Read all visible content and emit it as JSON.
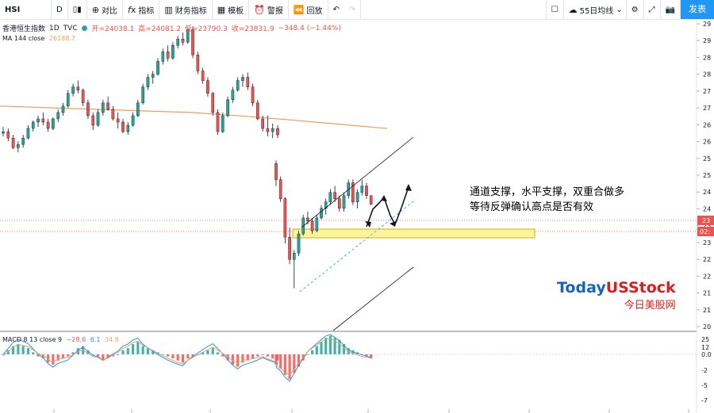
{
  "toolbar": {
    "symbol": "HSI",
    "interval": "D",
    "compare": "对比",
    "indicators": "指标",
    "financials": "财务指标",
    "templates": "模板",
    "alert": "警报",
    "replay": "回放",
    "ma_setting": "55日均线",
    "publish": "发表"
  },
  "legend": {
    "name": "香港恒生指数",
    "interval": "1D",
    "source": "TVC",
    "open": "开=24038.1",
    "high": "高=24081.2",
    "low": "低=23790.3",
    "close": "收=23831.9",
    "change": "−348.4 (−1.44%)",
    "ma_label": "MA 144 close",
    "ma_value": "26188.7",
    "macd_label": "MACD 8 13 close 9",
    "macd_hist": "−28.6",
    "macd_line": "6.1",
    "macd_signal": "34.8"
  },
  "annotation": {
    "line1": "通道支撑，水平支撑，双重合做多",
    "line2": "等待反弹确认高点是否有效"
  },
  "watermark": {
    "brand_a": "Today",
    "brand_b": "USStock",
    "cn": "今日美股网"
  },
  "price_axis": {
    "ticks": [
      "29",
      "29",
      "28",
      "28",
      "27",
      "27",
      "26",
      "26",
      "25",
      "25",
      "24",
      "24",
      "23",
      "23",
      "22",
      "22",
      "21",
      "21",
      "20"
    ],
    "last_price": "23",
    "countdown": "02:"
  },
  "macd_axis": {
    "ticks": [
      "25",
      "12",
      "0.0",
      "-2",
      "-5",
      "-7"
    ]
  },
  "colors": {
    "up": "#26a69a",
    "down": "#ef5350",
    "ma": "#e8a060",
    "macd_line": "#2196f3",
    "signal_line": "#e8a060",
    "zone_fill": "#fff59d",
    "zone_stroke": "#d4b000",
    "brand_blue": "#1565c0",
    "brand_red": "#d62020"
  },
  "chart_data": [
    {
      "type": "candlestick",
      "title": "",
      "series": [
        {
          "name": "HSI",
          "ohlc": [
            [
              26.05,
              26.25,
              25.95,
              26.1
            ],
            [
              26.1,
              26.2,
              25.8,
              25.9
            ],
            [
              25.9,
              26.0,
              25.55,
              25.6
            ],
            [
              25.6,
              25.8,
              25.45,
              25.7
            ],
            [
              25.7,
              26.0,
              25.6,
              25.9
            ],
            [
              25.9,
              26.3,
              25.85,
              26.2
            ],
            [
              26.2,
              26.45,
              26.1,
              26.4
            ],
            [
              26.4,
              26.6,
              26.25,
              26.5
            ],
            [
              26.5,
              26.7,
              26.3,
              26.4
            ],
            [
              26.4,
              26.5,
              26.1,
              26.2
            ],
            [
              26.2,
              26.55,
              26.15,
              26.5
            ],
            [
              26.5,
              26.8,
              26.4,
              26.7
            ],
            [
              26.7,
              27.0,
              26.6,
              26.9
            ],
            [
              26.9,
              27.4,
              26.85,
              27.3
            ],
            [
              27.3,
              27.6,
              27.2,
              27.5
            ],
            [
              27.5,
              27.7,
              27.3,
              27.4
            ],
            [
              27.4,
              27.45,
              26.9,
              27.0
            ],
            [
              27.0,
              27.1,
              26.5,
              26.6
            ],
            [
              26.6,
              26.7,
              26.15,
              26.3
            ],
            [
              26.3,
              26.8,
              26.25,
              26.7
            ],
            [
              26.7,
              27.1,
              26.6,
              27.0
            ],
            [
              27.0,
              27.2,
              26.75,
              26.8
            ],
            [
              26.8,
              26.9,
              26.45,
              26.5
            ],
            [
              26.5,
              26.7,
              26.2,
              26.4
            ],
            [
              26.4,
              26.5,
              26.05,
              26.1
            ],
            [
              26.1,
              26.4,
              26.0,
              26.3
            ],
            [
              26.3,
              26.7,
              26.25,
              26.6
            ],
            [
              26.6,
              27.1,
              26.55,
              27.0
            ],
            [
              27.0,
              27.6,
              26.95,
              27.5
            ],
            [
              27.5,
              27.9,
              27.4,
              27.8
            ],
            [
              27.8,
              28.0,
              27.6,
              27.9
            ],
            [
              27.9,
              28.4,
              27.85,
              28.3
            ],
            [
              28.3,
              28.7,
              28.2,
              28.6
            ],
            [
              28.6,
              28.8,
              28.3,
              28.4
            ],
            [
              28.4,
              28.9,
              28.35,
              28.8
            ],
            [
              28.8,
              29.1,
              28.7,
              29.0
            ],
            [
              29.0,
              29.2,
              28.8,
              28.9
            ],
            [
              28.9,
              29.35,
              28.85,
              29.3
            ],
            [
              29.3,
              29.4,
              28.4,
              28.5
            ],
            [
              28.5,
              28.6,
              27.9,
              28.0
            ],
            [
              28.0,
              28.1,
              27.6,
              27.7
            ],
            [
              27.7,
              27.8,
              27.2,
              27.3
            ],
            [
              27.3,
              27.35,
              26.6,
              26.7
            ],
            [
              26.7,
              26.8,
              26.0,
              26.1
            ],
            [
              26.1,
              26.7,
              26.05,
              26.6
            ],
            [
              26.6,
              27.2,
              26.55,
              27.1
            ],
            [
              27.1,
              27.5,
              27.0,
              27.4
            ],
            [
              27.4,
              27.8,
              27.35,
              27.7
            ],
            [
              27.7,
              27.9,
              27.5,
              27.8
            ],
            [
              27.8,
              27.95,
              27.4,
              27.5
            ],
            [
              27.5,
              27.6,
              26.9,
              27.0
            ],
            [
              27.0,
              27.1,
              26.45,
              26.5
            ],
            [
              26.5,
              26.6,
              26.1,
              26.2
            ],
            [
              26.2,
              26.6,
              25.95,
              26.1
            ],
            [
              26.1,
              26.35,
              25.9,
              26.2
            ],
            [
              26.2,
              26.3,
              25.9,
              26.0
            ],
            [
              25.1,
              25.2,
              24.4,
              24.6
            ],
            [
              24.6,
              24.7,
              23.9,
              24.0
            ],
            [
              24.0,
              24.05,
              22.6,
              22.8
            ],
            [
              22.8,
              23.1,
              21.95,
              22.1
            ],
            [
              22.1,
              22.4,
              21.2,
              22.3
            ],
            [
              22.3,
              23.0,
              22.2,
              22.9
            ],
            [
              22.9,
              23.5,
              22.85,
              23.4
            ],
            [
              23.4,
              23.6,
              23.2,
              23.3
            ],
            [
              23.3,
              23.4,
              22.9,
              23.0
            ],
            [
              23.0,
              23.5,
              22.95,
              23.4
            ],
            [
              23.4,
              23.8,
              23.35,
              23.7
            ],
            [
              23.7,
              24.0,
              23.5,
              23.9
            ],
            [
              23.9,
              24.3,
              23.8,
              24.2
            ],
            [
              24.2,
              24.4,
              23.9,
              24.0
            ],
            [
              24.0,
              24.1,
              23.6,
              23.7
            ],
            [
              23.7,
              24.2,
              23.6,
              24.1
            ],
            [
              24.1,
              24.6,
              24.0,
              24.5
            ],
            [
              24.5,
              24.6,
              23.8,
              23.9
            ],
            [
              23.9,
              24.3,
              23.7,
              24.2
            ],
            [
              24.2,
              24.6,
              24.1,
              24.4
            ],
            [
              24.4,
              24.5,
              24.0,
              24.1
            ],
            [
              24.1,
              24.1,
              23.8,
              23.83
            ]
          ],
          "moving_average_144": [
            26.9,
            26.85,
            26.8,
            26.75,
            26.7,
            26.6,
            26.48,
            26.35,
            26.2
          ],
          "ylim": [
            19.9,
            29.6
          ]
        }
      ]
    },
    {
      "type": "bar+line",
      "title": "",
      "series": [
        {
          "name": "MACD",
          "values": [
            0,
            2,
            4,
            5,
            4,
            3,
            1,
            -1,
            -2,
            -4,
            -5,
            -3,
            -2,
            -1,
            1,
            3,
            4,
            2,
            0,
            -1,
            -3,
            -2,
            -1,
            0,
            2,
            3,
            5,
            6,
            4,
            3,
            2,
            1,
            0,
            -1,
            -2,
            -3,
            -4,
            -2,
            -1,
            0,
            1,
            2,
            3,
            1,
            -1,
            -3,
            -5,
            -6,
            -4,
            -3,
            -2,
            -1,
            0,
            -1,
            -2,
            -3,
            -5,
            -7,
            -10,
            -12,
            -9,
            -6,
            -3,
            0,
            2,
            4,
            6,
            8,
            9,
            8,
            7,
            5,
            3,
            2,
            1,
            0,
            -1,
            -2
          ]
        }
      ],
      "ylim": [
        -8,
        26
      ]
    }
  ]
}
